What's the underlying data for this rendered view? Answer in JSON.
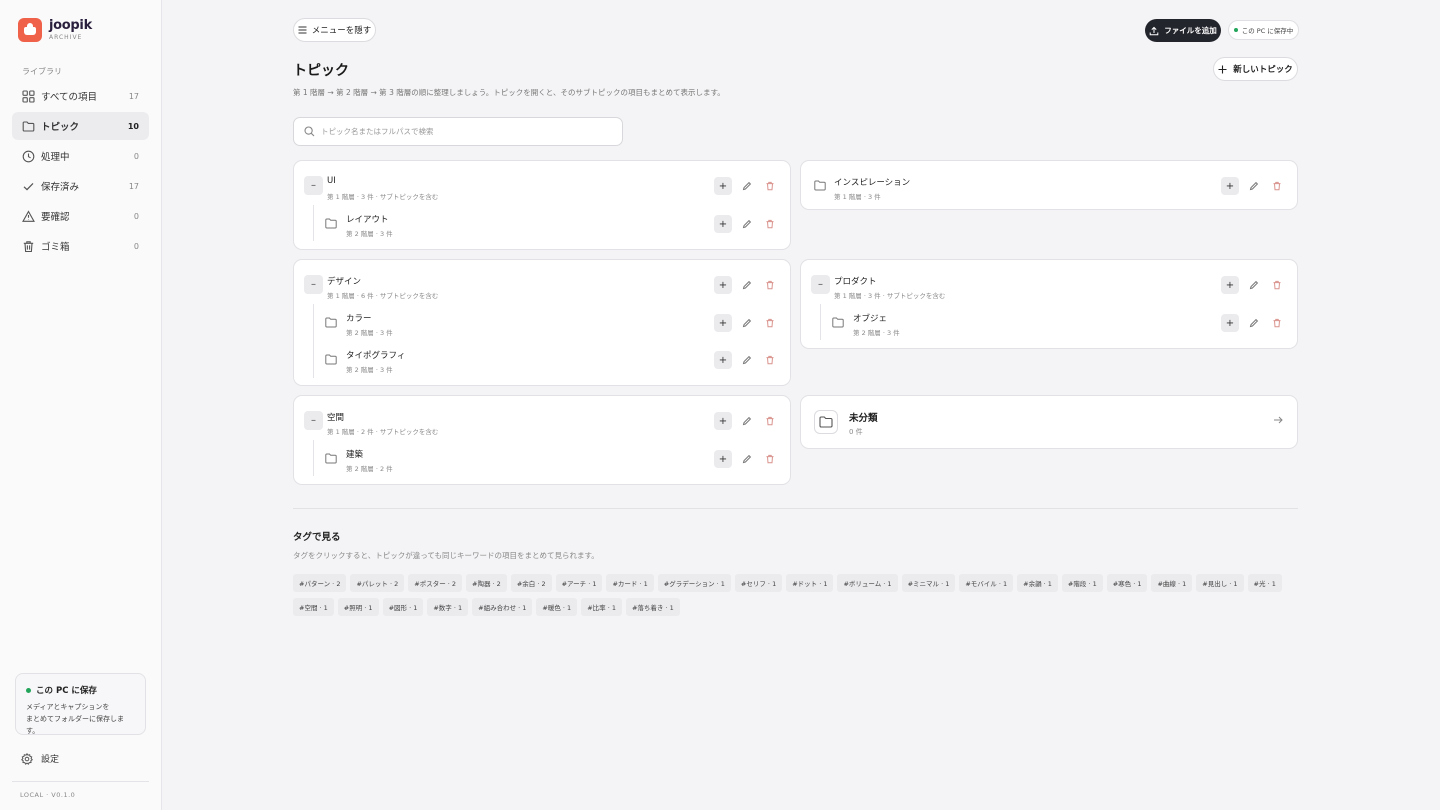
{
  "brand": {
    "name": "joopik",
    "sub": "ARCHIVE"
  },
  "sidebar": {
    "section_label": "ライブラリ",
    "items": [
      {
        "label": "すべての項目",
        "count": "17",
        "icon": "grid-icon"
      },
      {
        "label": "トピック",
        "count": "10",
        "icon": "folder-icon"
      },
      {
        "label": "処理中",
        "count": "0",
        "icon": "clock-icon"
      },
      {
        "label": "保存済み",
        "count": "17",
        "icon": "check-icon"
      },
      {
        "label": "要確認",
        "count": "0",
        "icon": "warning-icon"
      },
      {
        "label": "ゴミ箱",
        "count": "0",
        "icon": "trash-icon"
      }
    ],
    "save_card": {
      "title": "この PC に保存",
      "line1": "メディアとキャプションを",
      "line2": "まとめてフォルダーに保存します。"
    },
    "settings_label": "設定",
    "version": "LOCAL · V0.1.0"
  },
  "header": {
    "hide_menu": "メニューを隠す",
    "add_file": "ファイルを追加",
    "status": "この PC に保存中",
    "title": "トピック",
    "description": "第 1 階層 → 第 2 階層 → 第 3 階層の順に整理しましょう。トピックを開くと、そのサブトピックの項目もまとめて表示します。",
    "new_topic": "新しいトピック",
    "search_placeholder": "トピック名またはフルパスで検索"
  },
  "topics": {
    "ui": {
      "name": "UI",
      "meta": "第 1 階層 · 3 件 · サブトピックを含む",
      "children": [
        {
          "name": "レイアウト",
          "meta": "第 2 階層 · 3 件"
        }
      ]
    },
    "inspiration": {
      "name": "インスピレーション",
      "meta": "第 1 階層 · 3 件"
    },
    "design": {
      "name": "デザイン",
      "meta": "第 1 階層 · 6 件 · サブトピックを含む",
      "children": [
        {
          "name": "カラー",
          "meta": "第 2 階層 · 3 件"
        },
        {
          "name": "タイポグラフィ",
          "meta": "第 2 階層 · 3 件"
        }
      ]
    },
    "product": {
      "name": "プロダクト",
      "meta": "第 1 階層 · 3 件 · サブトピックを含む",
      "children": [
        {
          "name": "オブジェ",
          "meta": "第 2 階層 · 3 件"
        }
      ]
    },
    "space": {
      "name": "空間",
      "meta": "第 1 階層 · 2 件 · サブトピックを含む",
      "children": [
        {
          "name": "建築",
          "meta": "第 2 階層 · 2 件"
        }
      ]
    },
    "uncategorized": {
      "name": "未分類",
      "meta": "0 件"
    }
  },
  "tags_section": {
    "title": "タグで見る",
    "description": "タグをクリックすると、トピックが違っても同じキーワードの項目をまとめて見られます。",
    "tags": [
      "#パターン · 2",
      "#パレット · 2",
      "#ポスター · 2",
      "#陶器 · 2",
      "#余白 · 2",
      "#アーチ · 1",
      "#カード · 1",
      "#グラデーション · 1",
      "#セリフ · 1",
      "#ドット · 1",
      "#ボリューム · 1",
      "#ミニマル · 1",
      "#モバイル · 1",
      "#余韻 · 1",
      "#階段 · 1",
      "#寒色 · 1",
      "#曲線 · 1",
      "#見出し · 1",
      "#光 · 1",
      "#空間 · 1",
      "#照明 · 1",
      "#図形 · 1",
      "#数字 · 1",
      "#組み合わせ · 1",
      "#暖色 · 1",
      "#比率 · 1",
      "#落ち着き · 1"
    ]
  },
  "colors": {
    "accent": "#f0614a",
    "dark_button": "#23252c",
    "status_green": "#22a55a",
    "delete_red": "#d9928c"
  }
}
